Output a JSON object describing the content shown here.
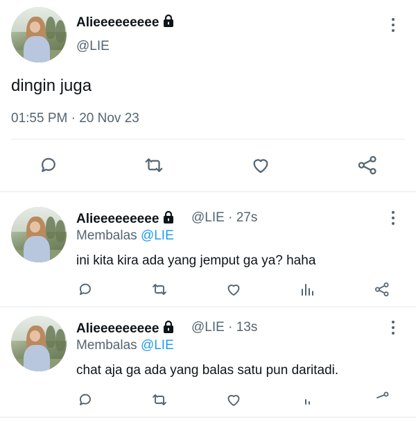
{
  "main_tweet": {
    "display_name": "Alieeeeeeeee",
    "handle": "@LIE",
    "text": "dingin juga",
    "timestamp": "01:55 PM · 20 Nov 23",
    "icons": [
      "avatar",
      "lock-icon",
      "more-icon",
      "reply-icon",
      "retweet-icon",
      "like-icon",
      "share-icon"
    ]
  },
  "replies": [
    {
      "display_name": "Alieeeeeeeee",
      "handle_time": "@LIE · 27s",
      "replying_label": "Membalas",
      "replying_to": "@LIE",
      "text": "ini kita kira ada yang jemput ga ya? haha"
    },
    {
      "display_name": "Alieeeeeeeee",
      "handle_time": "@LIE · 13s",
      "replying_label": "Membalas",
      "replying_to": "@LIE",
      "text": "chat aja ga ada yang balas satu pun daritadi."
    }
  ],
  "colors": {
    "text": "#0f1419",
    "muted": "#536471",
    "accent": "#1d9bf0",
    "divider": "#eff3f4"
  }
}
